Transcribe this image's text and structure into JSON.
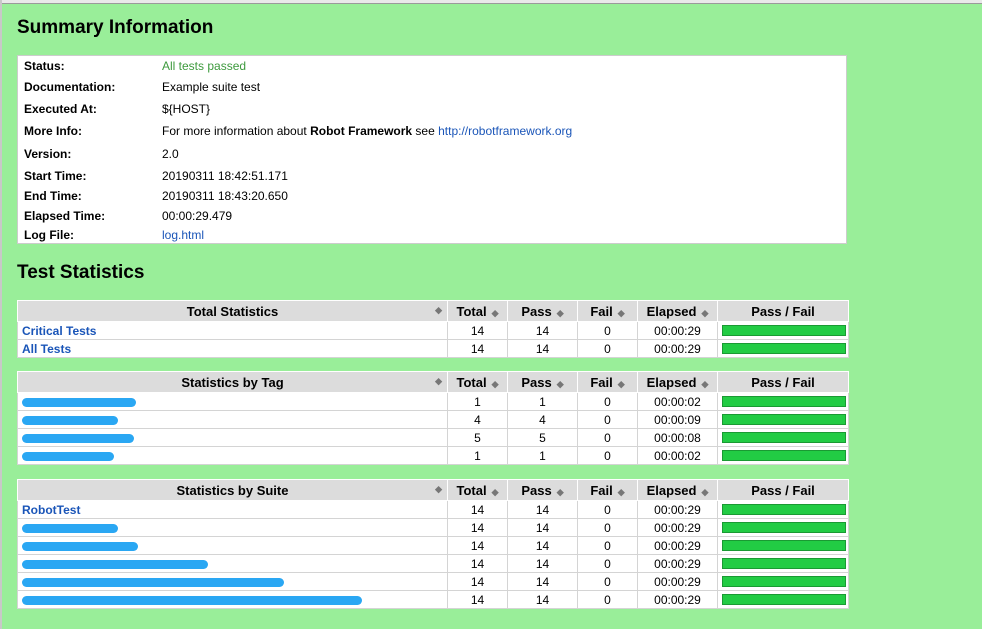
{
  "summary": {
    "heading": "Summary Information",
    "rows": [
      {
        "label": "Status:",
        "value": "All tests passed"
      },
      {
        "label": "Documentation:",
        "value": "Example suite test"
      },
      {
        "label": "Executed At:",
        "value": "${HOST}"
      },
      {
        "label": "More Info:",
        "value_prefix": "For more information about ",
        "value_bold": "Robot Framework",
        "value_mid": " see ",
        "value_link": "http://robotframework.org"
      },
      {
        "label": "Version:",
        "value": "2.0"
      },
      {
        "label": "Start Time:",
        "value": "20190311 18:42:51.171"
      },
      {
        "label": "End Time:",
        "value": "20190311 18:43:20.650"
      },
      {
        "label": "Elapsed Time:",
        "value": "00:00:29.479"
      },
      {
        "label": "Log File:",
        "value": "log.html"
      }
    ],
    "status_color": "#3d9a3d"
  },
  "stats": {
    "heading": "Test Statistics",
    "columns": [
      "Total",
      "Pass",
      "Fail",
      "Elapsed",
      "Pass / Fail"
    ],
    "sort_glyph": "◆",
    "total": {
      "header": "Total Statistics",
      "rows": [
        {
          "name": "Critical Tests",
          "total": "14",
          "pass": "14",
          "fail": "0",
          "elapsed": "00:00:29",
          "pass_fraction": 1.0
        },
        {
          "name": "All Tests",
          "total": "14",
          "pass": "14",
          "fail": "0",
          "elapsed": "00:00:29",
          "pass_fraction": 1.0
        }
      ]
    },
    "tag": {
      "header": "Statistics by Tag",
      "rows": [
        {
          "name": "",
          "total": "1",
          "pass": "1",
          "fail": "0",
          "elapsed": "00:00:02",
          "pass_fraction": 1.0
        },
        {
          "name": "",
          "total": "4",
          "pass": "4",
          "fail": "0",
          "elapsed": "00:00:09",
          "pass_fraction": 1.0
        },
        {
          "name": "",
          "total": "5",
          "pass": "5",
          "fail": "0",
          "elapsed": "00:00:08",
          "pass_fraction": 1.0
        },
        {
          "name": "",
          "total": "1",
          "pass": "1",
          "fail": "0",
          "elapsed": "00:00:02",
          "pass_fraction": 1.0
        }
      ]
    },
    "suite": {
      "header": "Statistics by Suite",
      "rows": [
        {
          "name": "RobotTest",
          "total": "14",
          "pass": "14",
          "fail": "0",
          "elapsed": "00:00:29",
          "pass_fraction": 1.0
        },
        {
          "name": "",
          "total": "14",
          "pass": "14",
          "fail": "0",
          "elapsed": "00:00:29",
          "pass_fraction": 1.0
        },
        {
          "name": "",
          "total": "14",
          "pass": "14",
          "fail": "0",
          "elapsed": "00:00:29",
          "pass_fraction": 1.0
        },
        {
          "name": "",
          "total": "14",
          "pass": "14",
          "fail": "0",
          "elapsed": "00:00:29",
          "pass_fraction": 1.0
        },
        {
          "name": "",
          "total": "14",
          "pass": "14",
          "fail": "0",
          "elapsed": "00:00:29",
          "pass_fraction": 1.0
        },
        {
          "name": "",
          "total": "14",
          "pass": "14",
          "fail": "0",
          "elapsed": "00:00:29",
          "pass_fraction": 1.0
        }
      ]
    }
  },
  "colors": {
    "background": "#99ee99",
    "pass_bar": "#22cc44",
    "link": "#1a55b8",
    "redaction": "#2aa7f3"
  }
}
